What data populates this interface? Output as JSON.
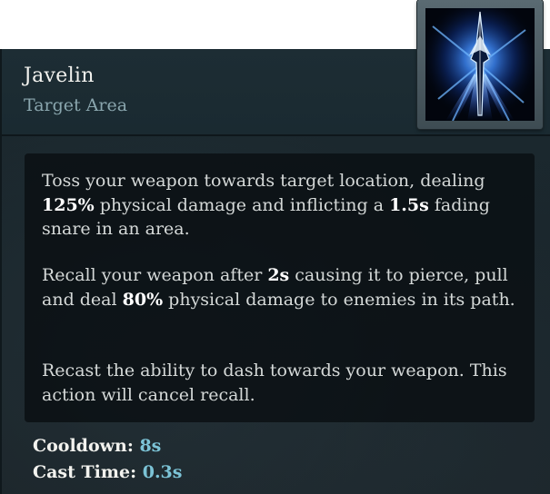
{
  "ability": {
    "name": "Javelin",
    "targeting": "Target Area"
  },
  "description": {
    "p1": [
      {
        "text": "Toss your weapon towards target location, dealing ",
        "bold": false
      },
      {
        "text": "125%",
        "bold": true
      },
      {
        "text": " physical damage and inflicting a ",
        "bold": false
      },
      {
        "text": "1.5s",
        "bold": true
      },
      {
        "text": " fading snare in an area.",
        "bold": false
      }
    ],
    "p2": [
      {
        "text": "Recall your weapon after ",
        "bold": false
      },
      {
        "text": "2s",
        "bold": true
      },
      {
        "text": " causing it to pierce, pull and deal ",
        "bold": false
      },
      {
        "text": "80%",
        "bold": true
      },
      {
        "text": " physical damage to enemies in its path.",
        "bold": false
      }
    ],
    "p3": [
      {
        "text": "Recast the ability to dash towards your weapon. This action will cancel recall.",
        "bold": false
      }
    ]
  },
  "stats": {
    "cooldown_label": "Cooldown:",
    "cooldown_value": "8s",
    "cast_time_label": "Cast Time:",
    "cast_time_value": "0.3s"
  },
  "icon": {
    "name": "javelin-ability-icon",
    "accent": "#3a8cff"
  },
  "colors": {
    "title": "#f2f2ee",
    "subtitle": "#8aa6ae",
    "stat_value": "#7cc3d6",
    "panel_bg": "#1b2a30"
  }
}
